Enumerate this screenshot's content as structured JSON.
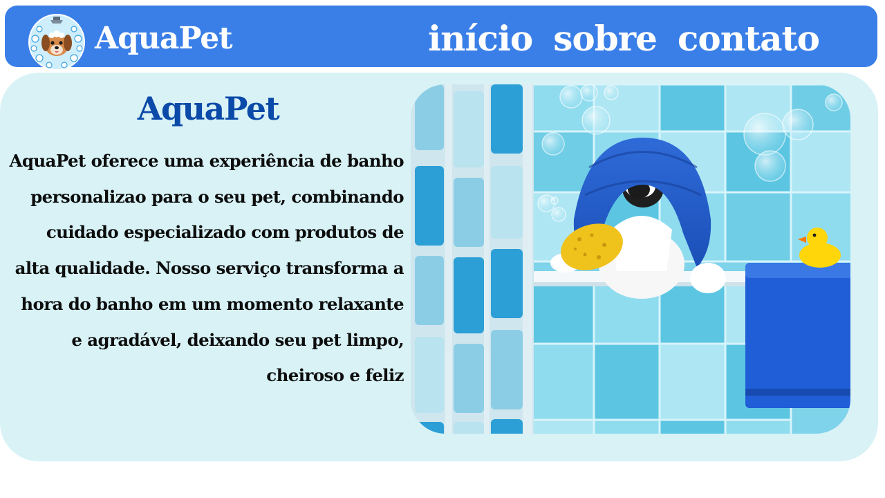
{
  "header": {
    "brand": "AquaPet",
    "logo_icon": "dog-bath-logo-icon",
    "nav": [
      "início",
      "sobre",
      "contato"
    ]
  },
  "hero": {
    "title": "AquaPet",
    "description": "AquaPet oferece uma experiência de banho personalizao para o seu pet, combinando cuidado especializado com produtos de alta qualidade. Nosso serviço transforma a hora do banho em um momento relaxante e agradável, deixando seu pet limpo, cheiroso e feliz",
    "image_subject": "dog in bathtub with blue towel, sponge and rubber duck"
  },
  "colors": {
    "header_bg": "#3a7fe8",
    "hero_bg": "#d8f2f6",
    "title_color": "#0b4aa8",
    "tile_blue": "#5cc6e2"
  }
}
